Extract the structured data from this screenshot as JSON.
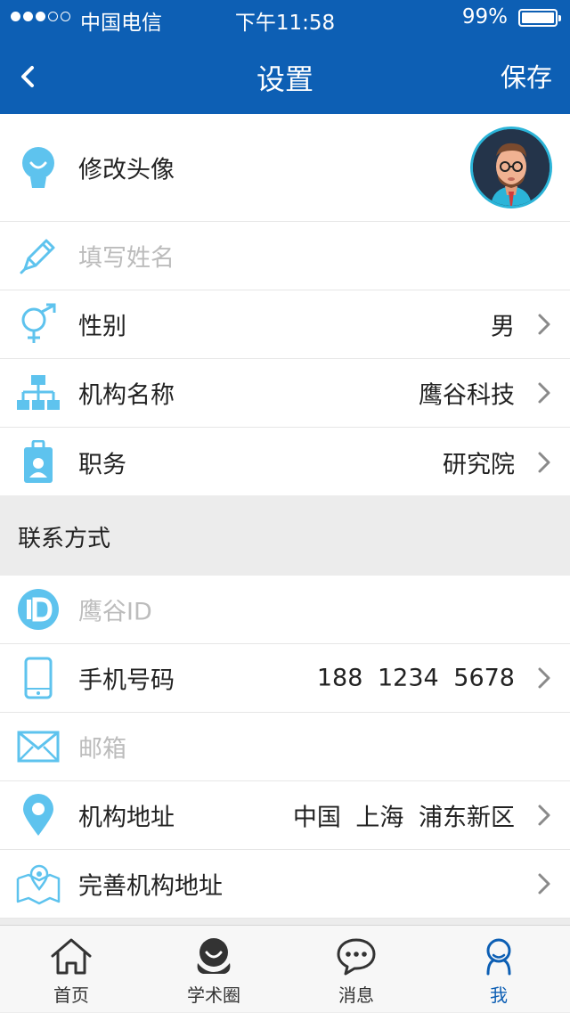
{
  "status_bar": {
    "signal_dots_filled": 3,
    "signal_dots_total": 5,
    "carrier": "中国电信",
    "time": "下午11:58",
    "battery": "99%"
  },
  "nav": {
    "back_icon": "chevron-left-icon",
    "title": "设置",
    "save_label": "保存"
  },
  "profile_rows": [
    {
      "icon": "avatar-head-icon",
      "label": "修改头像",
      "value": "",
      "has_avatar": true
    },
    {
      "icon": "pencil-icon",
      "label": "填写姓名",
      "value": "",
      "placeholder": true
    },
    {
      "icon": "gender-icon",
      "label": "性别",
      "value": "男",
      "chevron": true
    },
    {
      "icon": "org-chart-icon",
      "label": "机构名称",
      "value": "鹰谷科技",
      "chevron": true
    },
    {
      "icon": "badge-icon",
      "label": "职务",
      "value": "研究院",
      "chevron": true
    }
  ],
  "contact_section": {
    "title": "联系方式"
  },
  "contact_rows": [
    {
      "icon": "id-icon",
      "label": "鹰谷ID",
      "value": "",
      "placeholder": true
    },
    {
      "icon": "phone-icon",
      "label": "手机号码",
      "value": "188 1234 5678",
      "chevron": true
    },
    {
      "icon": "mail-icon",
      "label": "邮箱",
      "value": "",
      "placeholder": true
    },
    {
      "icon": "location-pin-icon",
      "label": "机构地址",
      "value": "中国 上海 浦东新区",
      "chevron": true
    },
    {
      "icon": "map-icon",
      "label": "完善机构地址",
      "value": "",
      "chevron": true
    }
  ],
  "tabbar": [
    {
      "icon": "home-icon",
      "label": "首页",
      "active": false
    },
    {
      "icon": "academic-circle-icon",
      "label": "学术圈",
      "active": false
    },
    {
      "icon": "message-icon",
      "label": "消息",
      "active": false
    },
    {
      "icon": "me-icon",
      "label": "我",
      "active": true
    }
  ],
  "colors": {
    "brand": "#0d5fb4",
    "icon_blue": "#5ec3ee",
    "chevron": "#8a8a8a"
  }
}
